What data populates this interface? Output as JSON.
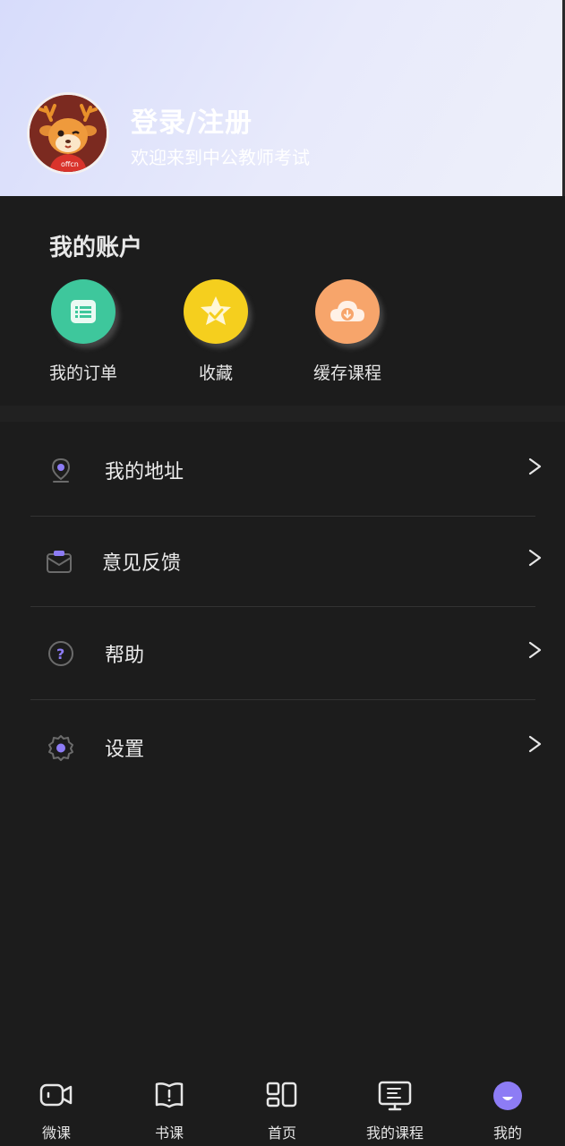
{
  "header": {
    "login_title": "登录/注册",
    "login_subtitle": "欢迎来到中公教师考试",
    "avatar_label": "offcn"
  },
  "account": {
    "title": "我的账户",
    "quick_actions": [
      {
        "label": "我的订单",
        "icon": "order-list-icon",
        "color": "#3ec79c"
      },
      {
        "label": "收藏",
        "icon": "star-icon",
        "color": "#f5cf1e"
      },
      {
        "label": "缓存课程",
        "icon": "cloud-download-icon",
        "color": "#f7a56b"
      }
    ]
  },
  "menu": [
    {
      "label": "我的地址",
      "icon": "location-pin-icon",
      "chevron": ">"
    },
    {
      "label": "意见反馈",
      "icon": "feedback-envelope-icon",
      "chevron": ">"
    },
    {
      "label": "帮助",
      "icon": "help-question-icon",
      "chevron": ">"
    },
    {
      "label": "设置",
      "icon": "settings-gear-icon",
      "chevron": ">"
    }
  ],
  "tabbar": [
    {
      "label": "微课",
      "icon": "video-camera-icon"
    },
    {
      "label": "书课",
      "icon": "book-icon"
    },
    {
      "label": "首页",
      "icon": "home-grid-icon"
    },
    {
      "label": "我的课程",
      "icon": "my-course-monitor-icon"
    },
    {
      "label": "我的",
      "icon": "profile-active-icon",
      "active": true
    }
  ],
  "colors": {
    "background": "#1c1c1c",
    "accent": "#8d7cf5",
    "header_gradient_start": "#d7dcfb"
  }
}
